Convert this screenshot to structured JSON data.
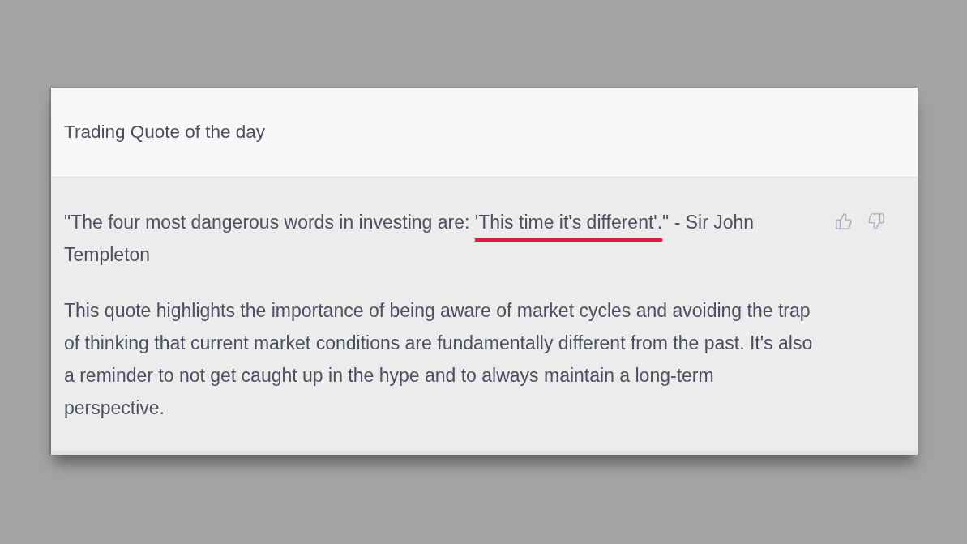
{
  "prompt": {
    "text": "Trading Quote of the day"
  },
  "response": {
    "quote": [
      {
        "text": "\"The four most dangerous words in investing are: ",
        "underlined": false
      },
      {
        "text": "'This time it's different'.",
        "underlined": true
      },
      {
        "text": "\" - Sir John Templeton",
        "underlined": false
      }
    ],
    "explanation": "This quote highlights the importance of being aware of market cycles and avoiding the trap of thinking that current market conditions are fundamentally different from the past. It's also a reminder to not get caught up in the hype and to always maintain a long-term perspective.",
    "feedback": [
      {
        "kind": "thumbs_up"
      },
      {
        "kind": "thumbs_down"
      }
    ]
  }
}
